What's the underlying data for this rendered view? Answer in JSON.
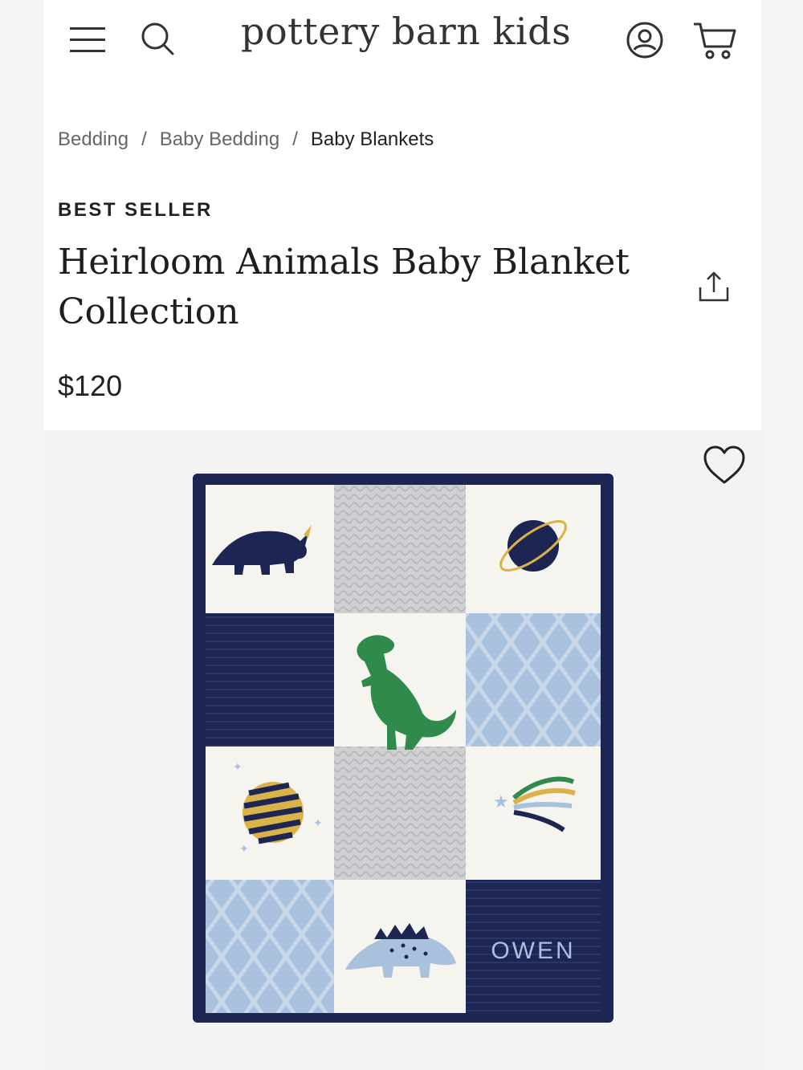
{
  "header": {
    "brand": "pottery barn kids",
    "icons": [
      "menu-icon",
      "search-icon",
      "account-icon",
      "cart-icon"
    ]
  },
  "breadcrumb": {
    "items": [
      "Bedding",
      "Baby Bedding",
      "Baby Blankets"
    ],
    "separator": "/"
  },
  "product": {
    "badge": "BEST SELLER",
    "title": "Heirloom Animals Baby Blanket Collection",
    "price": "$120",
    "personalization_text": "OWEN"
  },
  "colors": {
    "navy": "#1d2652",
    "light_blue": "#a9c1dc",
    "gray_knit": "#cfd0d2",
    "cream": "#f6f4ef",
    "green": "#2f8a4c",
    "gold": "#d9b24a"
  }
}
